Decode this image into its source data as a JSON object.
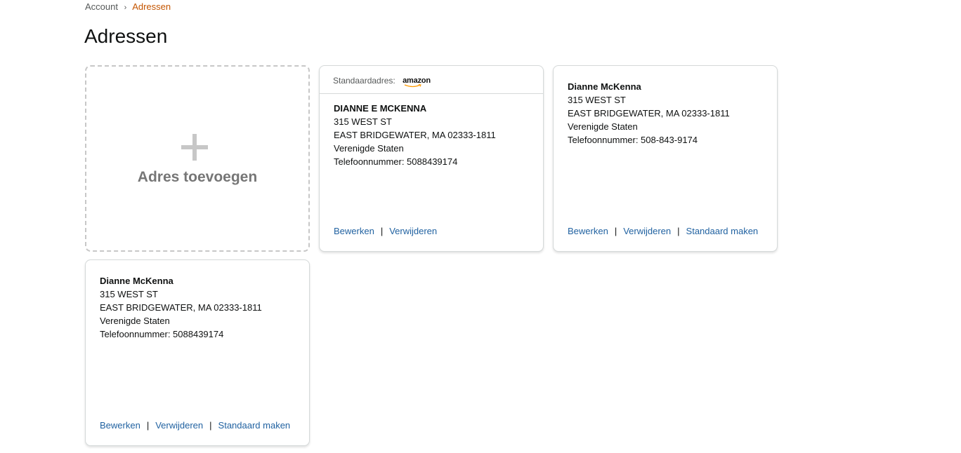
{
  "breadcrumb": {
    "account": "Account",
    "separator": "›",
    "current": "Adressen"
  },
  "title": "Adressen",
  "add_tile": {
    "label": "Adres toevoegen",
    "icon": "plus-icon"
  },
  "colors": {
    "link": "#2162a1",
    "breadcrumb_current": "#c45500",
    "dashed_border": "#c7c7c7"
  },
  "cards": [
    {
      "default_label": "Standaardadres:",
      "logo_text": "amazon",
      "name": "DIANNE E MCKENNA",
      "street": "315 WEST ST",
      "city": "EAST BRIDGEWATER, MA 02333-1811",
      "country": "Verenigde Staten",
      "phone": "Telefoonnummer: 5088439174",
      "actions": {
        "edit": "Bewerken",
        "delete": "Verwijderen"
      }
    },
    {
      "name": "Dianne McKenna",
      "street": "315 WEST ST",
      "city": "EAST BRIDGEWATER, MA 02333-1811",
      "country": "Verenigde Staten",
      "phone": "Telefoonnummer: 508-843-9174",
      "actions": {
        "edit": "Bewerken",
        "delete": "Verwijderen",
        "make_default": "Standaard maken"
      }
    },
    {
      "name": "Dianne McKenna",
      "street": "315 WEST ST",
      "city": "EAST BRIDGEWATER, MA 02333-1811",
      "country": "Verenigde Staten",
      "phone": "Telefoonnummer: 5088439174",
      "actions": {
        "edit": "Bewerken",
        "delete": "Verwijderen",
        "make_default": "Standaard maken"
      }
    }
  ],
  "action_separator": "|"
}
